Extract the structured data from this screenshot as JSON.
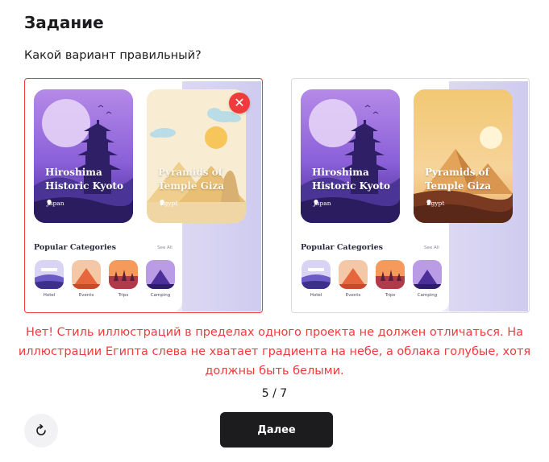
{
  "task": {
    "heading": "Задание",
    "question": "Какой вариант правильный?"
  },
  "options": [
    {
      "id": "left",
      "state": "wrong",
      "cards": [
        {
          "title": "Hiroshima Historic Kyoto",
          "location": "Japan"
        },
        {
          "title": "Pyramids of Temple Giza",
          "location": "Egypt"
        }
      ],
      "section_title": "Popular Categories",
      "see_all": "See All",
      "categories": [
        "Hotel",
        "Events",
        "Trips",
        "Camping"
      ]
    },
    {
      "id": "right",
      "state": "neutral",
      "cards": [
        {
          "title": "Hiroshima Historic Kyoto",
          "location": "Japan"
        },
        {
          "title": "Pyramids of Temple Giza",
          "location": "Egypt"
        }
      ],
      "section_title": "Popular Categories",
      "see_all": "See All",
      "categories": [
        "Hotel",
        "Events",
        "Trips",
        "Camping"
      ]
    }
  ],
  "feedback": {
    "text": "Нет! Стиль иллюстраций в пределах одного проекта не должен отличаться. На иллюстрации Египта слева не хватает градиента на небе, а облака голубые, хотя должны быть белыми.",
    "color": "#ef3b3b"
  },
  "progress": "5 / 7",
  "buttons": {
    "next_label": "Далее",
    "refresh_icon": "refresh-icon"
  },
  "colors": {
    "accent_dark": "#1c1c1f",
    "error": "#ef3b3b"
  }
}
